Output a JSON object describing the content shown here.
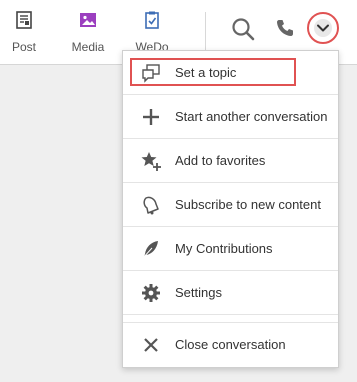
{
  "toolbar": {
    "post_label": "Post",
    "media_label": "Media",
    "wedo_label": "WeDo"
  },
  "menu": {
    "items": [
      {
        "label": "Set a topic",
        "icon": "chat-bubble-icon"
      },
      {
        "label": "Start another conversation",
        "icon": "plus-icon"
      },
      {
        "label": "Add to favorites",
        "icon": "star-plus-icon"
      },
      {
        "label": "Subscribe to new content",
        "icon": "bell-icon"
      },
      {
        "label": "My Contributions",
        "icon": "feather-icon"
      },
      {
        "label": "Settings",
        "icon": "gear-icon"
      },
      {
        "label": "Close conversation",
        "icon": "close-icon"
      }
    ]
  },
  "colors": {
    "highlight": "#e05252",
    "media_icon": "#9b3fbf",
    "wedo_icon": "#3d6db5"
  }
}
